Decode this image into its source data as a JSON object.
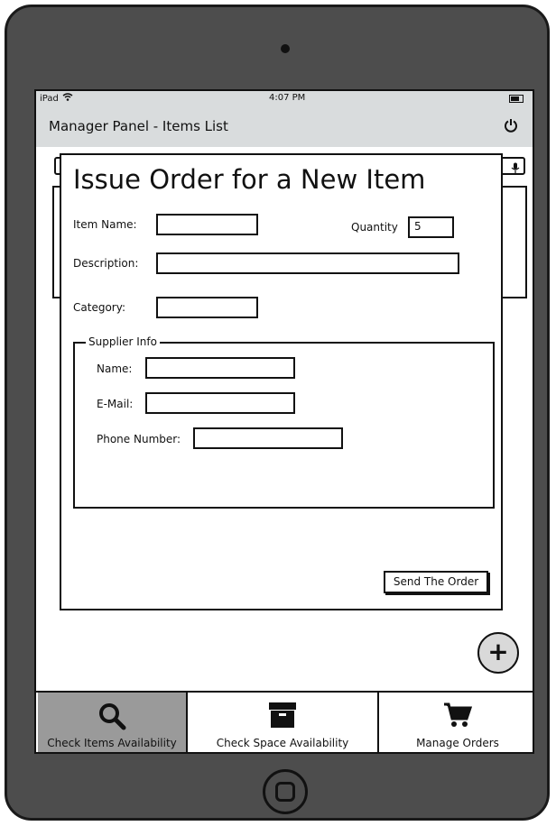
{
  "status_bar": {
    "carrier": "iPad",
    "time": "4:07 PM"
  },
  "nav": {
    "title": "Manager Panel - Items List"
  },
  "modal": {
    "title": "Issue Order for a New Item",
    "item_name_label": "Item Name:",
    "item_name_value": "",
    "quantity_label": "Quantity",
    "quantity_value": "5",
    "description_label": "Description:",
    "description_value": "",
    "category_label": "Category:",
    "category_value": "",
    "supplier": {
      "legend": "Supplier Info",
      "name_label": "Name:",
      "name_value": "",
      "email_label": "E-Mail:",
      "email_value": "",
      "phone_label": "Phone Number:",
      "phone_value": ""
    },
    "send_button": "Send The Order"
  },
  "tabs": [
    {
      "label": "Check Items Availability",
      "icon": "search-icon",
      "active": true
    },
    {
      "label": "Check Space Availability",
      "icon": "archive-box-icon",
      "active": false
    },
    {
      "label": "Manage Orders",
      "icon": "shopping-cart-icon",
      "active": false
    }
  ],
  "fab": {
    "icon": "plus-icon"
  },
  "colors": {
    "bar_bg": "#d9dcdd",
    "active_tab": "#9a9a9a",
    "device": "#4d4d4d"
  }
}
